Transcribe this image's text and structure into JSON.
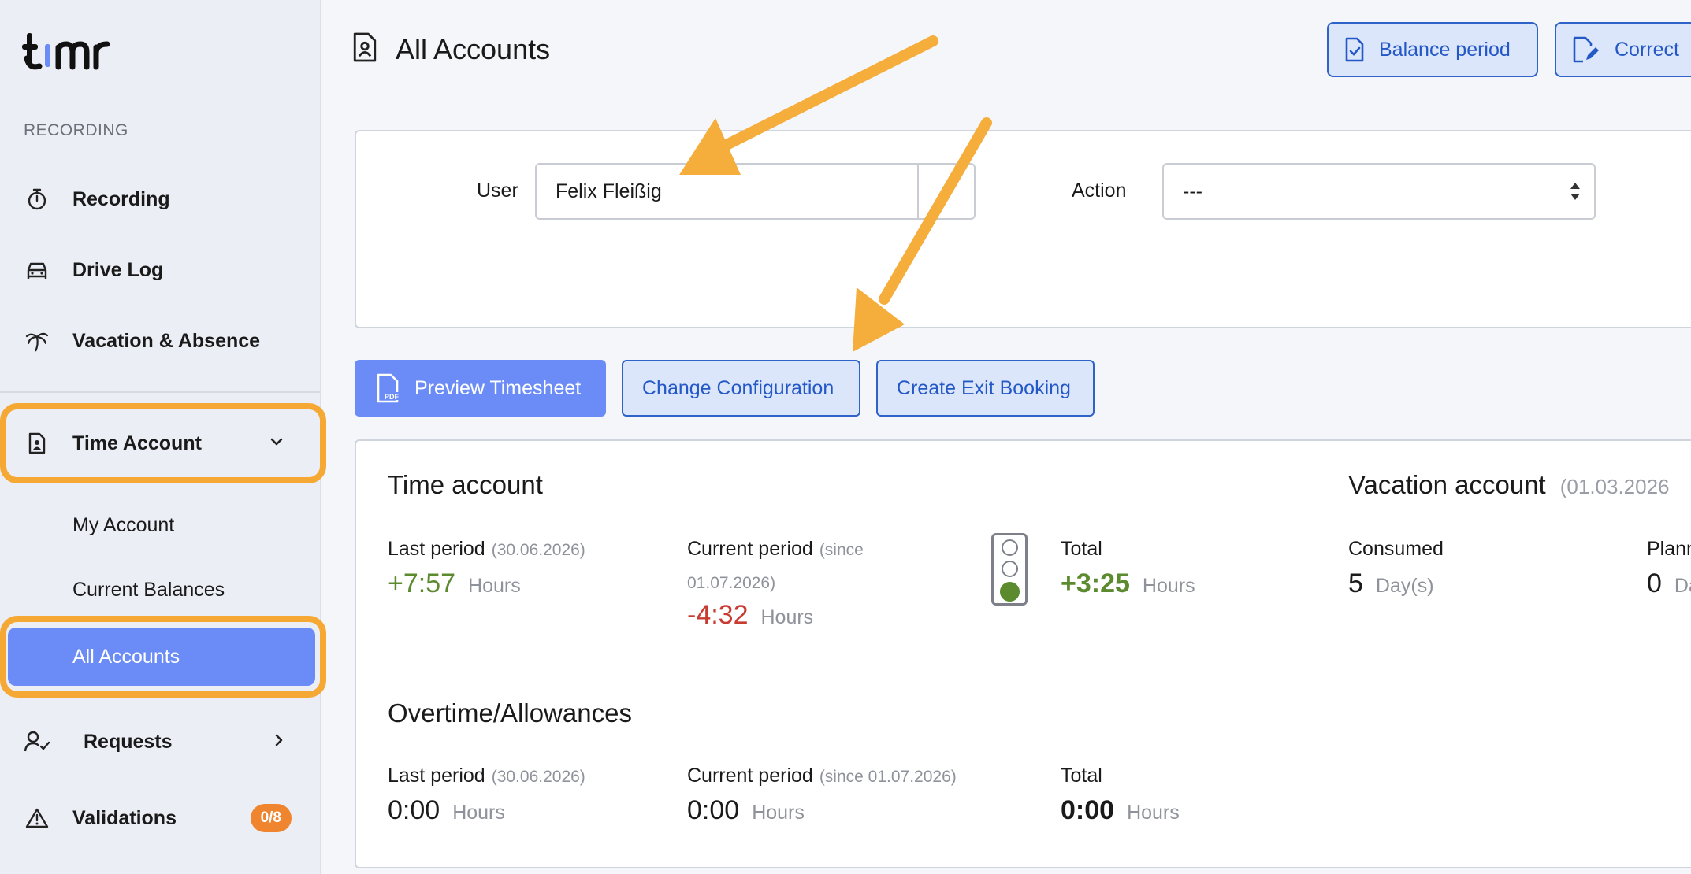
{
  "brand": {
    "logo_text": "timr"
  },
  "sidebar": {
    "section_label": "RECORDING",
    "items": [
      {
        "label": "Recording",
        "icon": "stopwatch-icon"
      },
      {
        "label": "Drive Log",
        "icon": "car-icon"
      },
      {
        "label": "Vacation & Absence",
        "icon": "palm-tree-icon"
      },
      {
        "label": "Time Account",
        "icon": "person-file-icon",
        "expanded": true
      },
      {
        "label": "Requests",
        "icon": "person-check-icon"
      },
      {
        "label": "Validations",
        "icon": "warning-icon",
        "badge": "0/8"
      }
    ],
    "sub_items": [
      {
        "label": "My Account"
      },
      {
        "label": "Current Balances"
      },
      {
        "label": "All Accounts",
        "active": true
      }
    ]
  },
  "header": {
    "title": "All Accounts",
    "buttons": [
      {
        "label": "Balance period",
        "icon": "file-check-icon"
      },
      {
        "label": "Correct",
        "icon": "file-edit-icon"
      }
    ]
  },
  "filters": {
    "user_label": "User",
    "user_value": "Felix Fleißig",
    "user_clear": "×",
    "action_label": "Action",
    "action_value": "---"
  },
  "actions": {
    "preview_label": "Preview Timesheet",
    "change_config_label": "Change Configuration",
    "exit_booking_label": "Create Exit Booking"
  },
  "time_account": {
    "title": "Time account",
    "last_period_label": "Last period",
    "last_period_date": "(30.06.2026)",
    "last_period_value": "+7:57",
    "current_period_label": "Current period",
    "current_period_note_1": "(since",
    "current_period_note_2": "01.07.2026)",
    "current_period_value": "-4:32",
    "total_label": "Total",
    "total_value": "+3:25",
    "unit": "Hours",
    "status_light": "green"
  },
  "vacation_account": {
    "title": "Vacation account",
    "date": "(01.03.2026",
    "consumed_label": "Consumed",
    "consumed_value": "5",
    "consumed_unit": "Day(s)",
    "planned_label": "Plann",
    "planned_value": "0",
    "planned_unit": "Da"
  },
  "overtime": {
    "title": "Overtime/Allowances",
    "last_period_label": "Last period",
    "last_period_date": "(30.06.2026)",
    "last_period_value": "0:00",
    "current_period_label": "Current period",
    "current_period_note": "(since 01.07.2026)",
    "current_period_value": "0:00",
    "total_label": "Total",
    "total_value": "0:00",
    "unit": "Hours"
  },
  "colors": {
    "accent": "#6b8cf6",
    "highlight": "#f5a833",
    "positive": "#5b8a2f",
    "negative": "#c73b30",
    "badge": "#f0852f"
  }
}
